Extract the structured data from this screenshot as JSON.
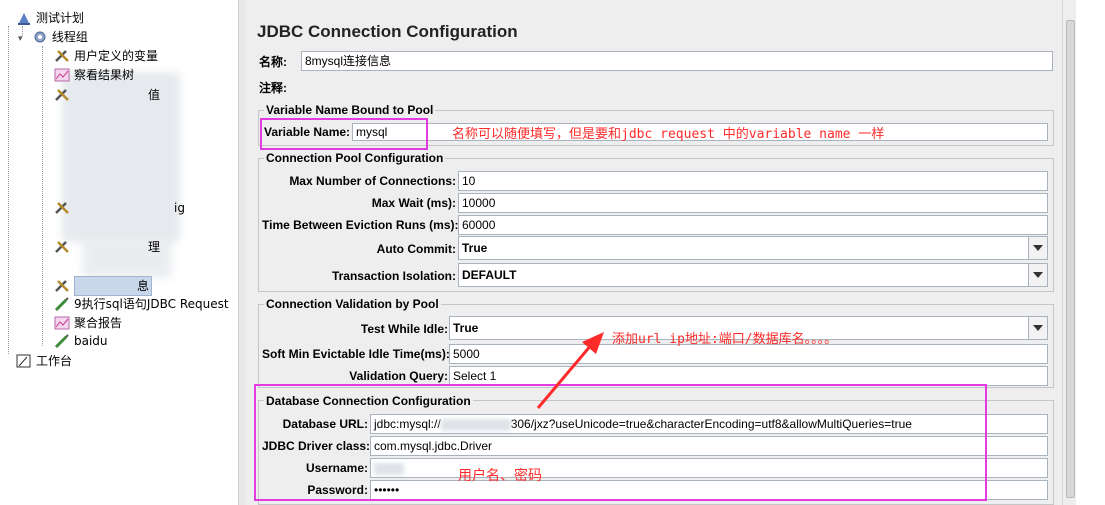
{
  "tree": {
    "items": [
      {
        "label": "测试计划"
      },
      {
        "label": "线程组"
      },
      {
        "label": "用户定义的变量"
      },
      {
        "label": "察看结果树"
      },
      {
        "label": "值"
      },
      {
        "label": "ig"
      },
      {
        "label": "理"
      },
      {
        "label": "息"
      },
      {
        "label": "9执行sql语句JDBC Request"
      },
      {
        "label": "聚合报告"
      },
      {
        "label": "baidu"
      },
      {
        "label": "工作台"
      }
    ]
  },
  "panel": {
    "title": "JDBC Connection Configuration",
    "name_label": "名称:",
    "name_value": "8mysql连接信息",
    "comment_label": "注释:",
    "comment_value": "",
    "var_group_title": "Variable Name Bound to Pool",
    "var_name_label": "Variable Name:",
    "var_name_value": "mysql",
    "pool_group_title": "Connection Pool Configuration",
    "max_conn_label": "Max Number of Connections:",
    "max_conn_value": "10",
    "max_wait_label": "Max Wait (ms):",
    "max_wait_value": "10000",
    "eviction_label": "Time Between Eviction Runs (ms):",
    "eviction_value": "60000",
    "auto_commit_label": "Auto Commit:",
    "auto_commit_value": "True",
    "isolation_label": "Transaction Isolation:",
    "isolation_value": "DEFAULT",
    "validation_group_title": "Connection Validation by Pool",
    "test_idle_label": "Test While Idle:",
    "test_idle_value": "True",
    "soft_min_label": "Soft Min Evictable Idle Time(ms):",
    "soft_min_value": "5000",
    "validation_query_label": "Validation Query:",
    "validation_query_value": "Select 1",
    "db_group_title": "Database Connection Configuration",
    "db_url_label": "Database URL:",
    "db_url_prefix": "jdbc:mysql://",
    "db_url_suffix": "306/jxz?useUnicode=true&characterEncoding=utf8&allowMultiQueries=true",
    "driver_label": "JDBC Driver class:",
    "driver_value": "com.mysql.jdbc.Driver",
    "username_label": "Username:",
    "username_value": "",
    "password_label": "Password:",
    "password_value": "••••••"
  },
  "annotations": {
    "variable_note": "名称可以随便填写，但是要和jdbc request 中的variable name 一样",
    "url_note": "添加url ip地址:端口/数据库名。。。。",
    "credential_note": "用户名、密码"
  },
  "colors": {
    "highlight": "#e23be0",
    "note_text": "#ff2a2a",
    "arrow": "#ff2a2a"
  }
}
